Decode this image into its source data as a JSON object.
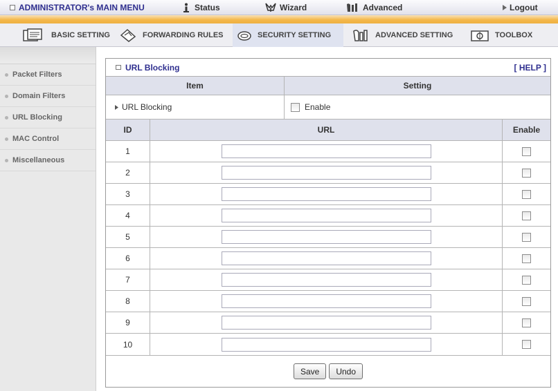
{
  "topbar": {
    "admin_menu": "ADMINISTRATOR's MAIN MENU",
    "status": "Status",
    "wizard": "Wizard",
    "advanced": "Advanced",
    "logout": "Logout"
  },
  "tabs": {
    "basic": "BASIC SETTING",
    "forwarding": "FORWARDING RULES",
    "security": "SECURITY SETTING",
    "advanced": "ADVANCED SETTING",
    "toolbox": "TOOLBOX",
    "active": "SECURITY SETTING"
  },
  "sidebar": {
    "items": [
      {
        "label": "Packet Filters"
      },
      {
        "label": "Domain Filters"
      },
      {
        "label": "URL Blocking"
      },
      {
        "label": "MAC Control"
      },
      {
        "label": "Miscellaneous"
      }
    ]
  },
  "panel": {
    "title": "URL Blocking",
    "help": "[ HELP ]",
    "col_item": "Item",
    "col_setting": "Setting",
    "url_blocking_label": "URL Blocking",
    "enable_label": "Enable",
    "enable_checked": false,
    "table": {
      "col_id": "ID",
      "col_url": "URL",
      "col_enable": "Enable",
      "rows": [
        {
          "id": "1",
          "url": "",
          "enabled": false
        },
        {
          "id": "2",
          "url": "",
          "enabled": false
        },
        {
          "id": "3",
          "url": "",
          "enabled": false
        },
        {
          "id": "4",
          "url": "",
          "enabled": false
        },
        {
          "id": "5",
          "url": "",
          "enabled": false
        },
        {
          "id": "6",
          "url": "",
          "enabled": false
        },
        {
          "id": "7",
          "url": "",
          "enabled": false
        },
        {
          "id": "8",
          "url": "",
          "enabled": false
        },
        {
          "id": "9",
          "url": "",
          "enabled": false
        },
        {
          "id": "10",
          "url": "",
          "enabled": false
        }
      ]
    },
    "save": "Save",
    "undo": "Undo"
  },
  "icons": {
    "admin": "square-icon",
    "status": "info-icon",
    "wizard": "wizard-icon",
    "advanced": "advanced-icon",
    "logout": "arrow-right-icon",
    "basic": "document-icon",
    "forwarding": "forwarding-icon",
    "security": "lock-icon",
    "advanced_setting": "tool-icon",
    "toolbox": "toolbox-icon"
  },
  "colors": {
    "accent": "#2f2f8f",
    "stripe": "#f4b84c",
    "header_bg": "#dfe1ec",
    "sidebar_bg": "#e9e9e9"
  }
}
